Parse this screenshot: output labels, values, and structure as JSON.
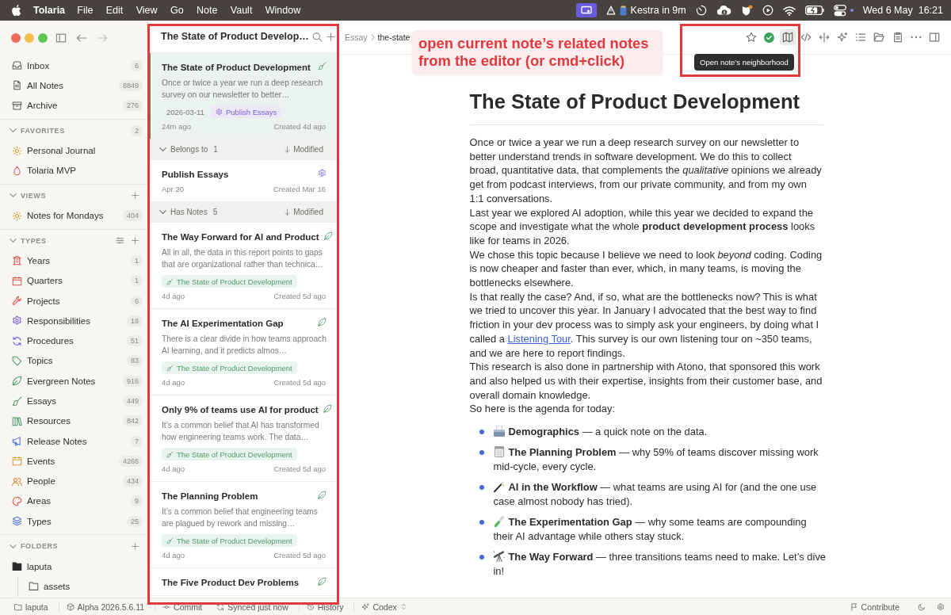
{
  "menu_bar": {
    "app_name": "Tolaria",
    "menus": [
      "File",
      "Edit",
      "View",
      "Go",
      "Note",
      "Vault",
      "Window"
    ],
    "reminder": "Kestra in 9m",
    "date": "Wed 6 May",
    "time": "16:21"
  },
  "sidebar": {
    "nav": [
      {
        "label": "Inbox",
        "count": "6"
      },
      {
        "label": "All Notes",
        "count": "8849"
      },
      {
        "label": "Archive",
        "count": "276"
      }
    ],
    "sections": [
      {
        "title": "FAVORITES",
        "expanded": true,
        "count": "2",
        "items": [
          {
            "label": "Personal Journal"
          },
          {
            "label": "Tolaria MVP"
          }
        ]
      },
      {
        "title": "VIEWS",
        "expanded": true,
        "items": [
          {
            "label": "Notes for Mondays",
            "count": "404"
          }
        ]
      },
      {
        "title": "TYPES",
        "expanded": true,
        "items": [
          {
            "label": "Years",
            "count": "1"
          },
          {
            "label": "Quarters",
            "count": "1"
          },
          {
            "label": "Projects",
            "count": "6"
          },
          {
            "label": "Responsibilities",
            "count": "18"
          },
          {
            "label": "Procedures",
            "count": "51"
          },
          {
            "label": "Topics",
            "count": "83"
          },
          {
            "label": "Evergreen Notes",
            "count": "916"
          },
          {
            "label": "Essays",
            "count": "449"
          },
          {
            "label": "Resources",
            "count": "842"
          },
          {
            "label": "Release Notes",
            "count": "7"
          },
          {
            "label": "Events",
            "count": "4266"
          },
          {
            "label": "People",
            "count": "434"
          },
          {
            "label": "Areas",
            "count": "9"
          },
          {
            "label": "Types",
            "count": "25"
          }
        ]
      },
      {
        "title": "FOLDERS",
        "expanded": true,
        "items": [
          {
            "label": "laputa",
            "children": [
              {
                "label": "assets"
              }
            ]
          }
        ]
      }
    ]
  },
  "note_list": {
    "title": "The State of Product Develop…",
    "items": [
      {
        "kind": "essay",
        "selected": true,
        "title": "The State of Product Development",
        "excerpt": "Once or twice a year we run a deep research survey on our newsletter to better…",
        "chips": [
          {
            "kind": "date",
            "label": "2026-03-11"
          },
          {
            "kind": "responsibility",
            "label": "Publish Essays"
          }
        ],
        "modified": "24m ago",
        "created": "Created 4d ago"
      },
      {
        "kind": "group",
        "label": "Belongs to",
        "count": "1",
        "sort": "Modified",
        "expanded": true
      },
      {
        "kind": "responsibility",
        "selected": false,
        "title": "Publish Essays",
        "modified": "Apr 20",
        "created": "Created Mar 16"
      },
      {
        "kind": "group",
        "label": "Has Notes",
        "count": "5",
        "sort": "Modified",
        "expanded": true
      },
      {
        "kind": "evergreen",
        "selected": false,
        "title": "The Way Forward for AI and Product",
        "excerpt": "All in all, the data in this report points to gaps that are organizational rather than technica…",
        "chips": [
          {
            "kind": "essay",
            "label": "The State of Product Development"
          }
        ],
        "modified": "4d ago",
        "created": "Created 5d ago"
      },
      {
        "kind": "evergreen",
        "selected": false,
        "title": "The AI Experimentation Gap",
        "excerpt": "There is a clear divide in how teams approach AI learning, and it predicts almos…",
        "chips": [
          {
            "kind": "essay",
            "label": "The State of Product Development"
          }
        ],
        "modified": "4d ago",
        "created": "Created 5d ago"
      },
      {
        "kind": "evergreen",
        "selected": false,
        "title": "Only 9% of teams use AI for product",
        "excerpt": "It’s a common belief that AI has transformed how engineering teams work. The data…",
        "chips": [
          {
            "kind": "essay",
            "label": "The State of Product Development"
          }
        ],
        "modified": "4d ago",
        "created": "Created 5d ago"
      },
      {
        "kind": "evergreen",
        "selected": false,
        "title": "The Planning Problem",
        "excerpt": "It’s a common belief that engineering teams are plagued by rework and missing…",
        "chips": [
          {
            "kind": "essay",
            "label": "The State of Product Development"
          }
        ],
        "modified": "4d ago",
        "created": "Created 5d ago"
      },
      {
        "kind": "evergreen",
        "selected": false,
        "title": "The Five Product Dev Problems"
      }
    ]
  },
  "editor": {
    "breadcrumb": [
      "Essay",
      "the-state"
    ],
    "tooltip": "Open note’s neighborhood",
    "title": "The State of Product Development",
    "paragraphs": [
      {
        "text": "Once or twice a year we run a deep research survey on our newsletter to better understand trends in software development. We do this to collect broad, quantitative data, that complements the *qualitative* opinions we already get from podcast interviews, from our private community, and from my own 1:1 conversations."
      },
      {
        "text": "Last year we explored AI adoption, while this year we decided to expand the scope and investigate what the whole **product development process** looks like for teams in 2026."
      },
      {
        "text": "We chose this topic because I believe we need to look *beyond* coding. Coding is now cheaper and faster than ever, which, in many teams, is moving the bottlenecks elsewhere."
      },
      {
        "text": "Is that really the case? And, if so, what are the bottlenecks now? This is what we tried to uncover this year. In January I advocated that the best way to find friction in your dev process was to simply ask your engineers, by doing what I called a ",
        "link": "Listening Tour",
        "after": ". This survey is our own listening tour on ~350 teams, and we are here to report findings."
      },
      {
        "text": "This research is also done in partnership with Atono, that sponsored this work and also helped us with their expertise, insights from their customer base, and overall domain knowledge."
      },
      {
        "text": "So here is the agenda for today:"
      }
    ],
    "agenda": [
      "**Demographics** — a quick note on the data.",
      "**The Planning Problem** — why 59% of teams discover missing work mid-cycle, every cycle.",
      "**AI in the Workflow** — what teams are using AI for (and the one use case almost nobody has tried).",
      "**The Experimentation Gap** — why some teams are compounding their AI advantage while others stay stuck.",
      "**The Way Forward** — three transitions teams need to make. Let’s dive in!"
    ]
  },
  "annotation": {
    "callout": "open current note’s related notes from the editor (or cmd+click)"
  },
  "status_bar": {
    "items": [
      "laputa",
      "Alpha 2026.5.6.11",
      "Commit",
      "Synced just now",
      "History",
      "Codex"
    ],
    "contribute": "Contribute"
  }
}
